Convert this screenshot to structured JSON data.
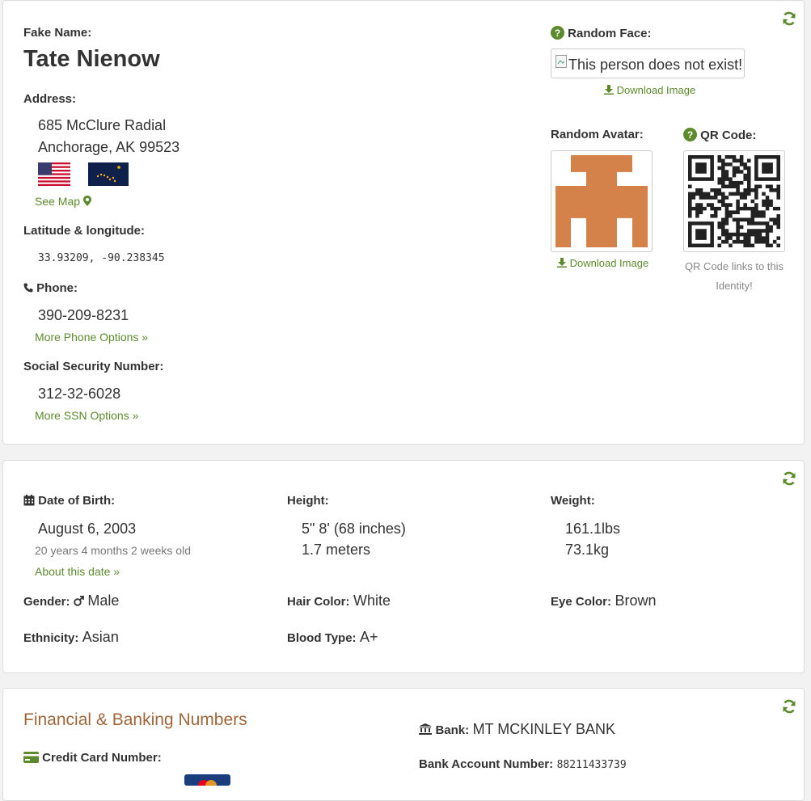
{
  "identity": {
    "fake_name_label": "Fake Name:",
    "name": "Tate Nienow",
    "address_label": "Address:",
    "address_line1": "685 McClure Radial",
    "address_line2": "Anchorage, AK 99523",
    "see_map": "See Map",
    "latlng_label": "Latitude & longitude:",
    "latlng": "33.93209, -90.238345",
    "phone_label": "Phone:",
    "phone": "390-209-8231",
    "more_phone": "More Phone Options »",
    "ssn_label": "Social Security Number:",
    "ssn": "312-32-6028",
    "more_ssn": "More SSN Options »",
    "random_face_label": "Random Face:",
    "face_alt": "This person does not exist!",
    "download_image": "Download Image",
    "random_avatar_label": "Random Avatar:",
    "qr_label": "QR Code:",
    "qr_note_line1": "QR Code links to this",
    "qr_note_line2": "Identity!"
  },
  "details": {
    "dob_label": "Date of Birth:",
    "dob": "August 6, 2003",
    "age": "20 years 4 months 2 weeks old",
    "about_date": "About this date »",
    "height_label": "Height:",
    "height_imperial": "5\" 8' (68 inches)",
    "height_metric": "1.7 meters",
    "weight_label": "Weight:",
    "weight_lbs": "161.1lbs",
    "weight_kg": "73.1kg",
    "gender_label": "Gender:",
    "gender": "Male",
    "hair_label": "Hair Color:",
    "hair": "White",
    "eye_label": "Eye Color:",
    "eye": "Brown",
    "ethnicity_label": "Ethnicity:",
    "ethnicity": "Asian",
    "blood_label": "Blood Type:",
    "blood": "A+"
  },
  "finance": {
    "title": "Financial & Banking Numbers",
    "credit_card_label": "Credit Card Number:",
    "bank_label": "Bank:",
    "bank": "MT MCKINLEY BANK",
    "account_label": "Bank Account Number:",
    "account": "88211433739"
  },
  "colors": {
    "accent_green": "#5d8a2d",
    "finance_title": "#a0663a",
    "avatar": "#d4824a"
  },
  "icons": [
    "refresh-icon",
    "question-icon",
    "download-icon",
    "map-marker-icon",
    "phone-icon",
    "calendar-icon",
    "male-icon",
    "bank-icon",
    "credit-card-icon"
  ]
}
